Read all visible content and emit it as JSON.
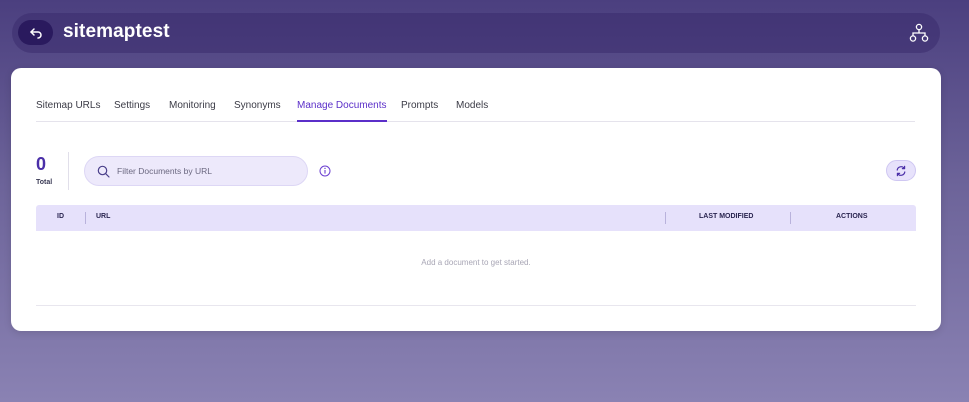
{
  "header": {
    "title": "sitemaptest",
    "back_icon": "back-arrow-icon",
    "sitemap_icon": "sitemap-icon"
  },
  "tabs": [
    {
      "label": "Sitemap URLs",
      "active": false
    },
    {
      "label": "Settings",
      "active": false
    },
    {
      "label": "Monitoring",
      "active": false
    },
    {
      "label": "Synonyms",
      "active": false
    },
    {
      "label": "Manage Documents",
      "active": true
    },
    {
      "label": "Prompts",
      "active": false
    },
    {
      "label": "Models",
      "active": false
    }
  ],
  "summary": {
    "total_count": "0",
    "total_label": "Total"
  },
  "search": {
    "placeholder": "Filter Documents by URL",
    "value": ""
  },
  "table": {
    "columns": [
      "ID",
      "URL",
      "LAST MODIFIED",
      "ACTIONS"
    ],
    "rows": [],
    "empty_message": "Add a document to get started."
  },
  "colors": {
    "accent": "#5b2fc9",
    "header_bg": "#2a1a5e",
    "table_header_bg": "#e6e1fb"
  }
}
